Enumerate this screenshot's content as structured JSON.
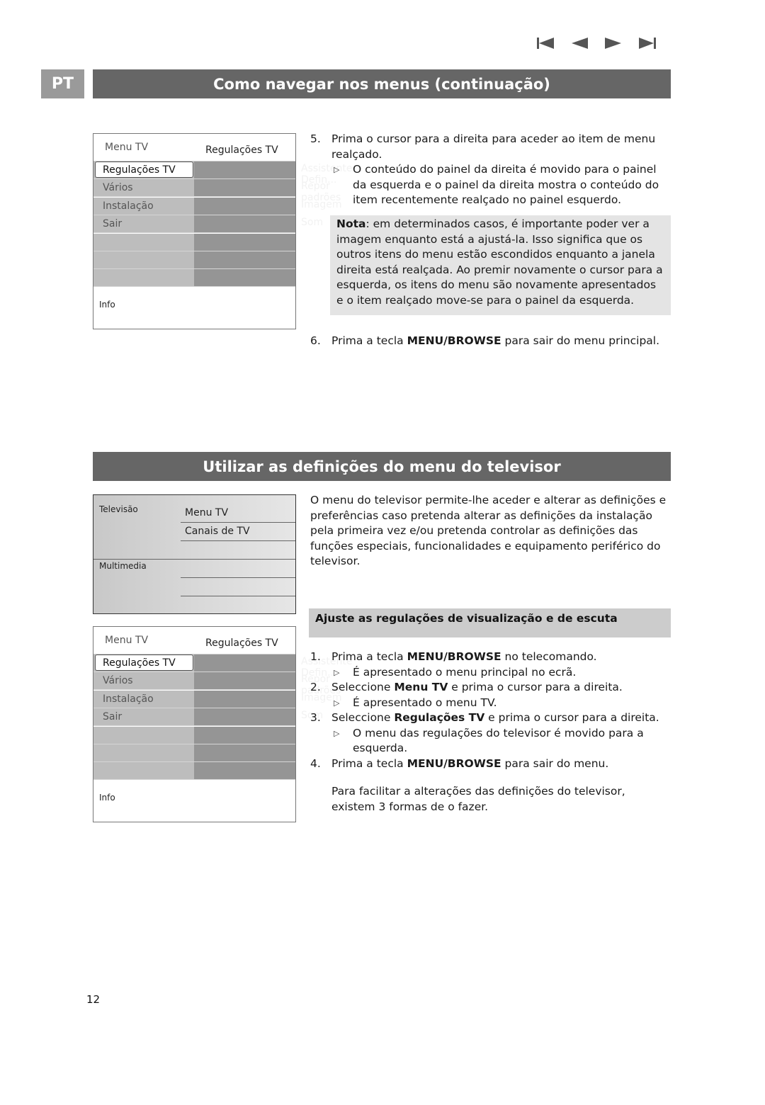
{
  "nav_icons": [
    "skip-back-icon",
    "previous-icon",
    "next-icon",
    "skip-forward-icon"
  ],
  "language_tag": "PT",
  "section1": {
    "title": "Como navegar nos menus (continuação)",
    "menu": {
      "left_header": "Menu TV",
      "right_header": "Regulações TV",
      "left_items": [
        "Regulações TV",
        "Vários",
        "Instalação",
        "Sair",
        "",
        "",
        ""
      ],
      "right_items": [
        "Assistente Defin...",
        "Repor padrões",
        "Imagem",
        "Som",
        "",
        "",
        ""
      ],
      "selected_index": 0,
      "info_label": "Info"
    },
    "step5": {
      "number": "5.",
      "text": "Prima o cursor para a direita para aceder ao item de menu realçado.",
      "sub": "O conteúdo do painel da direita é movido para o painel da esquerda e o painel da direita mostra o conteúdo do item recentemente realçado no painel esquerdo."
    },
    "note": {
      "label": "Nota",
      "text": ": em determinados casos, é importante poder ver a imagem enquanto está a ajustá-la. Isso significa que os outros itens do menu estão escondidos enquanto a janela direita está realçada. Ao premir novamente o cursor para a esquerda, os itens do menu são novamente apresentados e o item realçado move-se para o painel da esquerda."
    },
    "step6": {
      "number": "6.",
      "pre": "Prima a tecla ",
      "bold": "MENU/BROWSE",
      "post": " para sair do menu principal."
    }
  },
  "section2": {
    "title": "Utilizar as definições do menu do televisor",
    "tv_menu": {
      "group1": "Televisão",
      "group2": "Multimedia",
      "items": [
        "Menu TV",
        "Canais de TV"
      ]
    },
    "menu": {
      "left_header": "Menu TV",
      "right_header": "Regulações TV",
      "left_items": [
        "Regulações TV",
        "Vários",
        "Instalação",
        "Sair",
        "",
        "",
        ""
      ],
      "right_items": [
        "Assistente Defin...",
        "Repor padrões",
        "Imagem",
        "Som",
        "",
        "",
        ""
      ],
      "selected_index": 0,
      "info_label": "Info"
    },
    "intro": "O menu do televisor permite-lhe aceder e alterar as definições e preferências caso pretenda alterar as definições da instalação pela primeira vez e/ou pretenda controlar as definições das funções especiais, funcionalidades e equipamento periférico do televisor.",
    "subheading": "Ajuste as regulações de visualização e de escuta",
    "steps": [
      {
        "number": "1.",
        "pre": "Prima a tecla ",
        "bold": "MENU/BROWSE",
        "post": " no telecomando.",
        "sub": "É apresentado o menu principal no ecrã."
      },
      {
        "number": "2.",
        "pre": "Seleccione ",
        "bold": "Menu TV",
        "post": " e prima o cursor para a direita.",
        "sub": "É apresentado o menu TV."
      },
      {
        "number": "3.",
        "pre": "Seleccione ",
        "bold": "Regulações TV",
        "post": " e prima o cursor para a direita.",
        "sub": "O menu das regulações do televisor é movido para a esquerda."
      },
      {
        "number": "4.",
        "pre": "Prima a tecla ",
        "bold": "MENU/BROWSE",
        "post": " para sair do menu.",
        "sub": ""
      }
    ],
    "closing": "Para facilitar a alterações das definições do televisor, existem 3 formas de o fazer."
  },
  "page_number": "12"
}
